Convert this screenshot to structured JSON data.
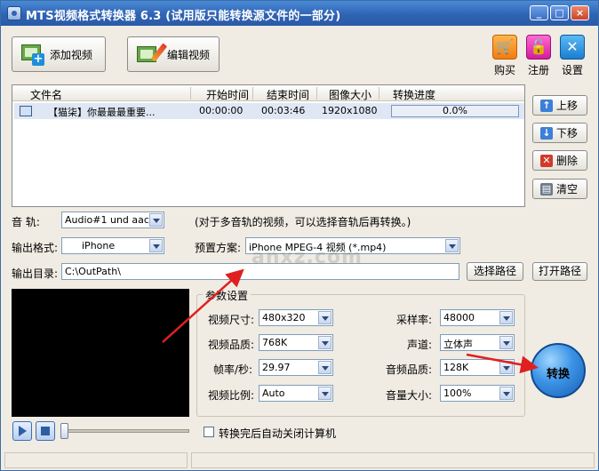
{
  "window": {
    "title": "MTS视频格式转换器 6.3 (试用版只能转换源文件的一部分)",
    "controls": [
      "_",
      "□",
      "×"
    ]
  },
  "toolbar": {
    "add_video": "添加视频",
    "edit_video": "编辑视频",
    "buy": "购买",
    "register": "注册",
    "settings": "设置"
  },
  "file_list": {
    "columns": [
      "文件名",
      "开始时间",
      "结束时间",
      "图像大小",
      "转换进度"
    ],
    "rows": [
      {
        "name": "【猫柒】你最最最重要...",
        "start": "00:00:00",
        "end": "00:03:46",
        "size": "1920x1080",
        "progress": "0.0%"
      }
    ]
  },
  "side_buttons": {
    "move_up": "上移",
    "move_down": "下移",
    "delete": "删除",
    "clear": "清空"
  },
  "audio_track": {
    "label": "音   轨:",
    "value": "Audio#1 und aac",
    "hint": "(对于多音轨的视频，可以选择音轨后再转换。)"
  },
  "output_format": {
    "label": "输出格式:",
    "value": "iPhone",
    "preset_label": "预置方案:",
    "preset_value": "iPhone MPEG-4 视频 (*.mp4)"
  },
  "output_dir": {
    "label": "输出目录:",
    "value": "C:\\OutPath\\",
    "choose": "选择路径",
    "open": "打开路径"
  },
  "params": {
    "legend": "参数设置",
    "video_size_label": "视频尺寸:",
    "video_size": "480x320",
    "video_quality_label": "视频品质:",
    "video_quality": "768K",
    "framerate_label": "帧率/秒:",
    "framerate": "29.97",
    "aspect_label": "视频比例:",
    "aspect": "Auto",
    "samplerate_label": "采样率:",
    "samplerate": "48000",
    "channel_label": "声道:",
    "channel": "立体声",
    "audio_quality_label": "音频品质:",
    "audio_quality": "128K",
    "volume_label": "音量大小:",
    "volume": "100%"
  },
  "convert": {
    "label": "转换"
  },
  "shutdown_option": "转换完后自动关闭计算机",
  "watermark": "anxz.com"
}
